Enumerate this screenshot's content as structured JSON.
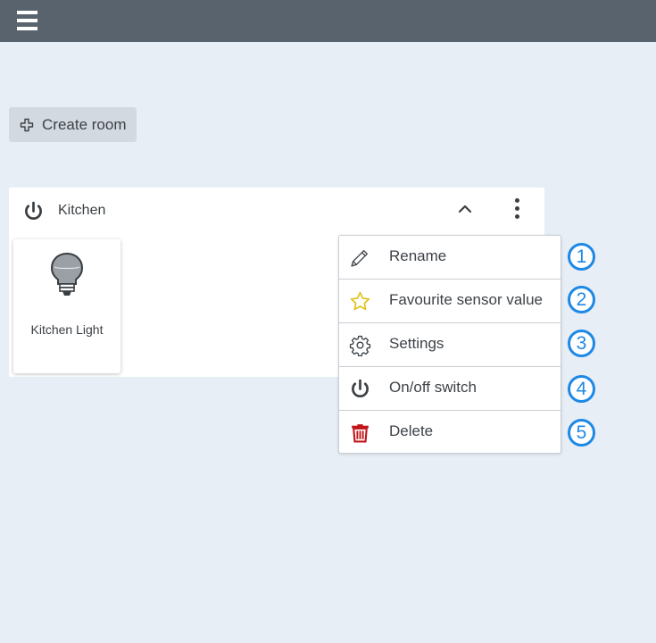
{
  "topbar": {
    "menu_icon": "hamburger-menu-icon",
    "background": "#58636e"
  },
  "create_room": {
    "label": "Create room",
    "icon": "plus-icon"
  },
  "room": {
    "name": "Kitchen",
    "power_icon": "power-icon",
    "collapse_icon": "chevron-up-icon",
    "more_icon": "more-vertical-icon",
    "devices": [
      {
        "name": "Kitchen Light",
        "icon": "lightbulb-icon"
      }
    ]
  },
  "context_menu": {
    "items": [
      {
        "label": "Rename",
        "icon": "pencil-icon"
      },
      {
        "label": "Favourite sensor value",
        "icon": "star-icon"
      },
      {
        "label": "Settings",
        "icon": "gear-icon"
      },
      {
        "label": "On/off switch",
        "icon": "power-icon"
      },
      {
        "label": "Delete",
        "icon": "trash-icon",
        "color": "#c0151b"
      }
    ]
  },
  "callouts": [
    "1",
    "2",
    "3",
    "4",
    "5"
  ],
  "colors": {
    "accent": "#1e88e5",
    "danger": "#c0151b",
    "star": "#e0c21a"
  }
}
